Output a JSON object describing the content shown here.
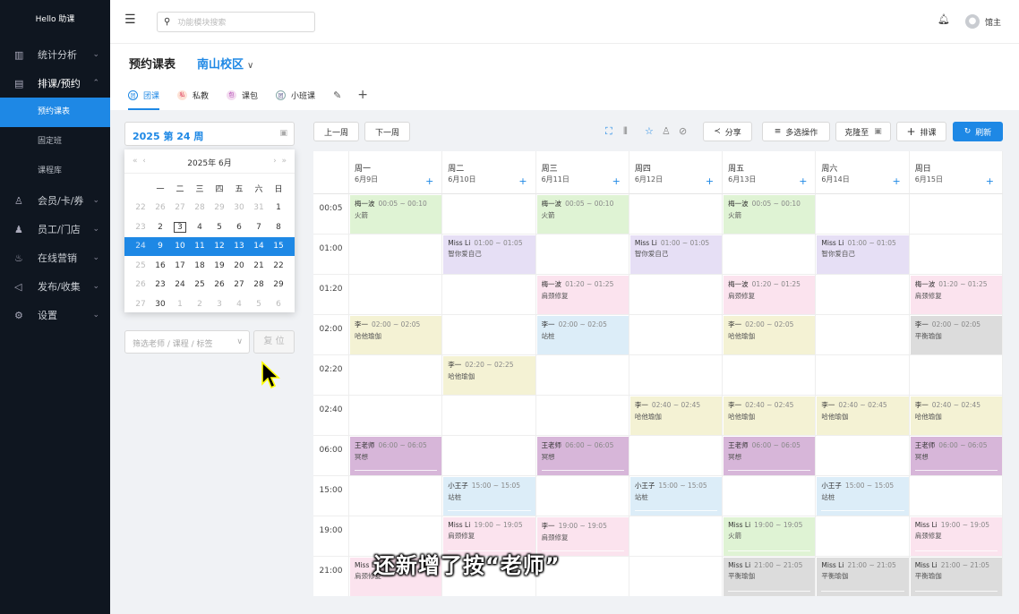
{
  "app": {
    "logo": "Hello 助课"
  },
  "sidebar": {
    "items": [
      {
        "label": "统计分析",
        "icon": "chart-icon",
        "chev": "⌄"
      },
      {
        "label": "排课/预约",
        "icon": "calendar-icon",
        "chev": "⌃"
      },
      {
        "label": "会员/卡/券",
        "icon": "member-icon",
        "chev": "⌄"
      },
      {
        "label": "员工/门店",
        "icon": "staff-icon",
        "chev": "⌄"
      },
      {
        "label": "在线营销",
        "icon": "marketing-icon",
        "chev": "⌄"
      },
      {
        "label": "发布/收集",
        "icon": "publish-icon",
        "chev": "⌄"
      },
      {
        "label": "设置",
        "icon": "settings-icon",
        "chev": "⌄"
      }
    ],
    "subitems": [
      "预约课表",
      "固定班",
      "课程库"
    ]
  },
  "topbar": {
    "search_placeholder": "功能模块搜索",
    "user_name": "馆主"
  },
  "header": {
    "title": "预约课表",
    "campus": "南山校区"
  },
  "tabs": [
    {
      "label": "团课",
      "badge": "团"
    },
    {
      "label": "私教",
      "badge": "私"
    },
    {
      "label": "课包",
      "badge": "包"
    },
    {
      "label": "小班课",
      "badge": "团"
    }
  ],
  "week": {
    "label": "2025 第 24 周"
  },
  "calendar": {
    "year_month": "2025年  6月",
    "weekdays": [
      "一",
      "二",
      "三",
      "四",
      "五",
      "六",
      "日"
    ],
    "rows": [
      [
        "22",
        "26",
        "27",
        "28",
        "29",
        "30",
        "31",
        "1"
      ],
      [
        "23",
        "2",
        "3",
        "4",
        "5",
        "6",
        "7",
        "8"
      ],
      [
        "24",
        "9",
        "10",
        "11",
        "12",
        "13",
        "14",
        "15"
      ],
      [
        "25",
        "16",
        "17",
        "18",
        "19",
        "20",
        "21",
        "22"
      ],
      [
        "26",
        "23",
        "24",
        "25",
        "26",
        "27",
        "28",
        "29"
      ],
      [
        "27",
        "30",
        "1",
        "2",
        "3",
        "4",
        "5",
        "6"
      ]
    ]
  },
  "filter": {
    "placeholder": "筛选老师 / 课程 / 标签",
    "reset": "复 位"
  },
  "toolbar": {
    "prev_week": "上一周",
    "next_week": "下一周",
    "share": "分享",
    "multi": "多选操作",
    "copy": "克隆至",
    "add": "排课",
    "refresh": "刷新"
  },
  "schedule": {
    "days": [
      {
        "wd": "周一",
        "date": "6月9日"
      },
      {
        "wd": "周二",
        "date": "6月10日"
      },
      {
        "wd": "周三",
        "date": "6月11日"
      },
      {
        "wd": "周四",
        "date": "6月12日"
      },
      {
        "wd": "周五",
        "date": "6月13日"
      },
      {
        "wd": "周六",
        "date": "6月14日"
      },
      {
        "wd": "周日",
        "date": "6月15日"
      }
    ],
    "times": [
      "00:05",
      "01:00",
      "01:20",
      "02:00",
      "02:20",
      "02:40",
      "06:00",
      "15:00",
      "19:00",
      "21:00"
    ],
    "events": [
      {
        "day": 0,
        "slot": 0,
        "teacher": "梅一波",
        "time": "00:05 ~ 00:10",
        "course": "火箭",
        "color": "#dff3d4"
      },
      {
        "day": 2,
        "slot": 0,
        "teacher": "梅一波",
        "time": "00:05 ~ 00:10",
        "course": "火箭",
        "color": "#dff3d4"
      },
      {
        "day": 4,
        "slot": 0,
        "teacher": "梅一波",
        "time": "00:05 ~ 00:10",
        "course": "火箭",
        "color": "#dff3d4"
      },
      {
        "day": 1,
        "slot": 1,
        "teacher": "Miss Li",
        "time": "01:00 ~ 01:05",
        "course": "智你爱自己",
        "color": "#e6dff5"
      },
      {
        "day": 3,
        "slot": 1,
        "teacher": "Miss Li",
        "time": "01:00 ~ 01:05",
        "course": "智你爱自己",
        "color": "#e6dff5"
      },
      {
        "day": 5,
        "slot": 1,
        "teacher": "Miss Li",
        "time": "01:00 ~ 01:05",
        "course": "智你爱自己",
        "color": "#e6dff5"
      },
      {
        "day": 2,
        "slot": 2,
        "teacher": "梅一波",
        "time": "01:20 ~ 01:25",
        "course": "肩颈修复",
        "color": "#fbe3ee"
      },
      {
        "day": 4,
        "slot": 2,
        "teacher": "梅一波",
        "time": "01:20 ~ 01:25",
        "course": "肩颈修复",
        "color": "#fbe3ee"
      },
      {
        "day": 6,
        "slot": 2,
        "teacher": "梅一波",
        "time": "01:20 ~ 01:25",
        "course": "肩颈修复",
        "color": "#fbe3ee"
      },
      {
        "day": 0,
        "slot": 3,
        "teacher": "李一",
        "time": "02:00 ~ 02:05",
        "course": "哈他瑜伽",
        "color": "#f4f2d4"
      },
      {
        "day": 2,
        "slot": 3,
        "teacher": "李一",
        "time": "02:00 ~ 02:05",
        "course": "站桩",
        "color": "#dcedf8"
      },
      {
        "day": 4,
        "slot": 3,
        "teacher": "李一",
        "time": "02:00 ~ 02:05",
        "course": "哈他瑜伽",
        "color": "#f4f2d4"
      },
      {
        "day": 6,
        "slot": 3,
        "teacher": "李一",
        "time": "02:00 ~ 02:05",
        "course": "平衡瑜伽",
        "color": "#dcdcdc"
      },
      {
        "day": 1,
        "slot": 4,
        "teacher": "李一",
        "time": "02:20 ~ 02:25",
        "course": "哈他瑜伽",
        "color": "#f4f2d4"
      },
      {
        "day": 3,
        "slot": 5,
        "teacher": "李一",
        "time": "02:40 ~ 02:45",
        "course": "哈他瑜伽",
        "color": "#f4f2d4"
      },
      {
        "day": 4,
        "slot": 5,
        "teacher": "李一",
        "time": "02:40 ~ 02:45",
        "course": "哈他瑜伽",
        "color": "#f4f2d4"
      },
      {
        "day": 5,
        "slot": 5,
        "teacher": "李一",
        "time": "02:40 ~ 02:45",
        "course": "哈他瑜伽",
        "color": "#f4f2d4"
      },
      {
        "day": 6,
        "slot": 5,
        "teacher": "李一",
        "time": "02:40 ~ 02:45",
        "course": "哈他瑜伽",
        "color": "#f4f2d4"
      },
      {
        "day": 0,
        "slot": 6,
        "teacher": "王老师",
        "time": "06:00 ~ 06:05",
        "course": "冥想",
        "color": "#d7b6d9",
        "bar": true
      },
      {
        "day": 2,
        "slot": 6,
        "teacher": "王老师",
        "time": "06:00 ~ 06:05",
        "course": "冥想",
        "color": "#d7b6d9",
        "bar": true
      },
      {
        "day": 4,
        "slot": 6,
        "teacher": "王老师",
        "time": "06:00 ~ 06:05",
        "course": "冥想",
        "color": "#d7b6d9",
        "bar": true
      },
      {
        "day": 6,
        "slot": 6,
        "teacher": "王老师",
        "time": "06:00 ~ 06:05",
        "course": "冥想",
        "color": "#d7b6d9",
        "bar": true
      },
      {
        "day": 1,
        "slot": 7,
        "teacher": "小王子",
        "time": "15:00 ~ 15:05",
        "course": "站桩",
        "color": "#dcedf8",
        "bar": true
      },
      {
        "day": 3,
        "slot": 7,
        "teacher": "小王子",
        "time": "15:00 ~ 15:05",
        "course": "站桩",
        "color": "#dcedf8",
        "bar": true
      },
      {
        "day": 5,
        "slot": 7,
        "teacher": "小王子",
        "time": "15:00 ~ 15:05",
        "course": "站桩",
        "color": "#dcedf8",
        "bar": true
      },
      {
        "day": 1,
        "slot": 8,
        "teacher": "Miss Li",
        "time": "19:00 ~ 19:05",
        "course": "肩颈修复",
        "color": "#fbe3ee",
        "bar": true
      },
      {
        "day": 2,
        "slot": 8,
        "teacher": "李一",
        "time": "19:00 ~ 19:05",
        "course": "肩颈修复",
        "color": "#fbe3ee",
        "bar": true
      },
      {
        "day": 4,
        "slot": 8,
        "teacher": "Miss Li",
        "time": "19:00 ~ 19:05",
        "course": "火箭",
        "color": "#dff3d4",
        "bar": true
      },
      {
        "day": 6,
        "slot": 8,
        "teacher": "Miss Li",
        "time": "19:00 ~ 19:05",
        "course": "肩颈修复",
        "color": "#fbe3ee",
        "bar": true
      },
      {
        "day": 0,
        "slot": 9,
        "teacher": "Miss Li",
        "time": "",
        "course": "肩颈修复",
        "color": "#fbe3ee"
      },
      {
        "day": 4,
        "slot": 9,
        "teacher": "Miss Li",
        "time": "21:00 ~ 21:05",
        "course": "平衡瑜伽",
        "color": "#dcdcdc",
        "bar": true
      },
      {
        "day": 5,
        "slot": 9,
        "teacher": "Miss Li",
        "time": "21:00 ~ 21:05",
        "course": "平衡瑜伽",
        "color": "#dcdcdc",
        "bar": true
      },
      {
        "day": 6,
        "slot": 9,
        "teacher": "Miss Li",
        "time": "21:00 ~ 21:05",
        "course": "平衡瑜伽",
        "color": "#dcdcdc",
        "bar": true
      }
    ]
  },
  "caption": "还新增了按“老师”"
}
